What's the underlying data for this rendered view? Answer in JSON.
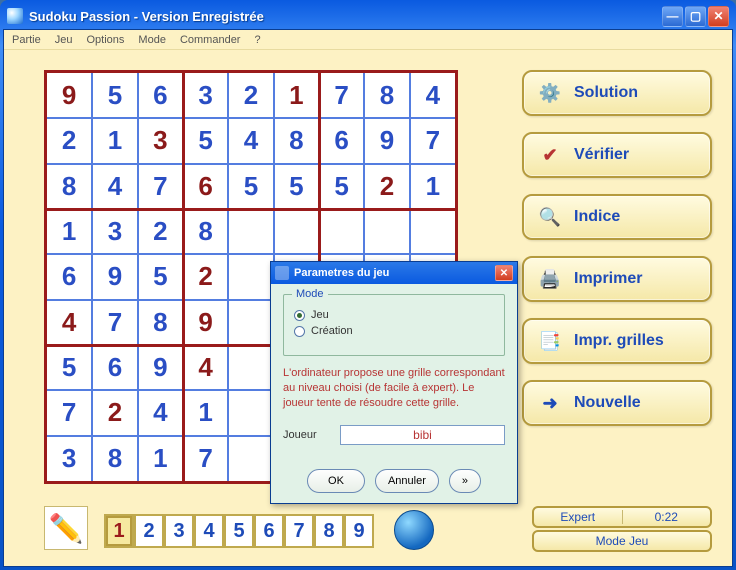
{
  "window": {
    "title": "Sudoku Passion - Version Enregistrée"
  },
  "menu": {
    "items": [
      "Partie",
      "Jeu",
      "Options",
      "Mode",
      "Commander",
      "?"
    ]
  },
  "grid": {
    "rows": [
      [
        {
          "v": "9",
          "g": true
        },
        {
          "v": "5"
        },
        {
          "v": "6"
        },
        {
          "v": "3"
        },
        {
          "v": "2"
        },
        {
          "v": "1",
          "g": true
        },
        {
          "v": "7"
        },
        {
          "v": "8"
        },
        {
          "v": "4"
        }
      ],
      [
        {
          "v": "2"
        },
        {
          "v": "1"
        },
        {
          "v": "3",
          "g": true
        },
        {
          "v": "5"
        },
        {
          "v": "4"
        },
        {
          "v": "8"
        },
        {
          "v": "6"
        },
        {
          "v": "9"
        },
        {
          "v": "7"
        }
      ],
      [
        {
          "v": "8"
        },
        {
          "v": "4"
        },
        {
          "v": "7"
        },
        {
          "v": "6",
          "g": true
        },
        {
          "v": "5"
        },
        {
          "v": "5"
        },
        {
          "v": "5"
        },
        {
          "v": "2",
          "g": true
        },
        {
          "v": "1"
        }
      ],
      [
        {
          "v": "1"
        },
        {
          "v": "3"
        },
        {
          "v": "2"
        },
        {
          "v": "8"
        },
        {
          "v": ""
        },
        {
          "v": ""
        },
        {
          "v": ""
        },
        {
          "v": ""
        },
        {
          "v": ""
        }
      ],
      [
        {
          "v": "6"
        },
        {
          "v": "9"
        },
        {
          "v": "5"
        },
        {
          "v": "2",
          "g": true
        },
        {
          "v": ""
        },
        {
          "v": ""
        },
        {
          "v": ""
        },
        {
          "v": ""
        },
        {
          "v": ""
        }
      ],
      [
        {
          "v": "4",
          "g": true
        },
        {
          "v": "7"
        },
        {
          "v": "8"
        },
        {
          "v": "9",
          "g": true
        },
        {
          "v": ""
        },
        {
          "v": ""
        },
        {
          "v": ""
        },
        {
          "v": ""
        },
        {
          "v": ""
        }
      ],
      [
        {
          "v": "5"
        },
        {
          "v": "6"
        },
        {
          "v": "9"
        },
        {
          "v": "4",
          "g": true
        },
        {
          "v": ""
        },
        {
          "v": ""
        },
        {
          "v": ""
        },
        {
          "v": ""
        },
        {
          "v": ""
        }
      ],
      [
        {
          "v": "7"
        },
        {
          "v": "2",
          "g": true
        },
        {
          "v": "4"
        },
        {
          "v": "1"
        },
        {
          "v": ""
        },
        {
          "v": ""
        },
        {
          "v": ""
        },
        {
          "v": ""
        },
        {
          "v": ""
        }
      ],
      [
        {
          "v": "3"
        },
        {
          "v": "8"
        },
        {
          "v": "1"
        },
        {
          "v": "7"
        },
        {
          "v": ""
        },
        {
          "v": ""
        },
        {
          "v": ""
        },
        {
          "v": ""
        },
        {
          "v": ""
        }
      ]
    ]
  },
  "buttons": {
    "solution": "Solution",
    "verifier": "Vérifier",
    "indice": "Indice",
    "imprimer": "Imprimer",
    "impr_grilles": "Impr. grilles",
    "nouvelle": "Nouvelle"
  },
  "numsel": {
    "selected": 1
  },
  "status": {
    "level": "Expert",
    "time": "0:22",
    "mode": "Mode Jeu"
  },
  "dialog": {
    "title": "Parametres du jeu",
    "group_label": "Mode",
    "radio_jeu": "Jeu",
    "radio_creation": "Création",
    "selected": "jeu",
    "description": "L'ordinateur propose une grille correspondant au niveau choisi (de facile à expert). Le joueur tente de résoudre cette grille.",
    "player_label": "Joueur",
    "player_value": "bibi",
    "ok": "OK",
    "cancel": "Annuler",
    "more": "»"
  }
}
